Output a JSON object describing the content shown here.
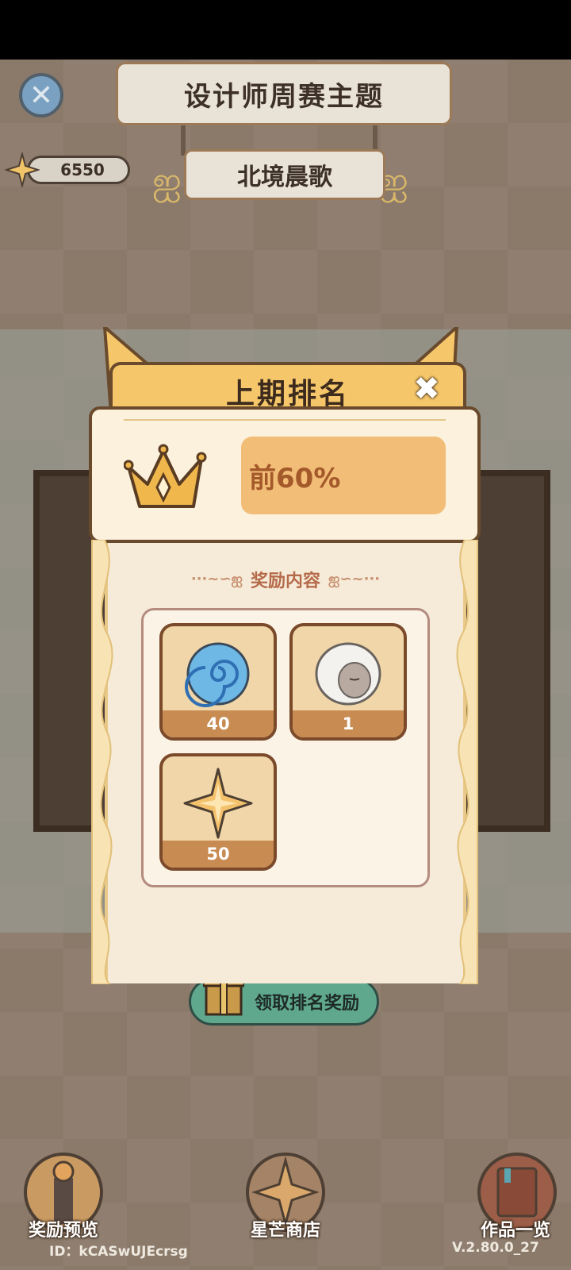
{
  "header": {
    "title": "设计师周赛主题",
    "subtitle": "北境晨歌",
    "star_count": "6550"
  },
  "modal": {
    "title": "上期排名",
    "rank_value": "前60%",
    "reward_heading": "奖励内容",
    "rewards": [
      {
        "icon": "blue-swirl-icon",
        "count": "40"
      },
      {
        "icon": "white-hair-avatar-icon",
        "count": "1"
      },
      {
        "icon": "star-icon",
        "count": "50"
      }
    ]
  },
  "claim_button": {
    "label": "领取排名奖励"
  },
  "bottom_nav": [
    {
      "label": "奖励预览",
      "icon": "trophy-icon"
    },
    {
      "label": "星芒商店",
      "icon": "star-icon"
    },
    {
      "label": "作品一览",
      "icon": "book-icon"
    }
  ],
  "footer": {
    "user_id": "ID：kCASwUJEcrsg",
    "version": "V.2.80.0_27"
  },
  "colors": {
    "modal_header": "#f6c76a",
    "rank_bar": "#f2bd77",
    "rank_text": "#a4592a",
    "claim_button": "#5fa88e"
  }
}
